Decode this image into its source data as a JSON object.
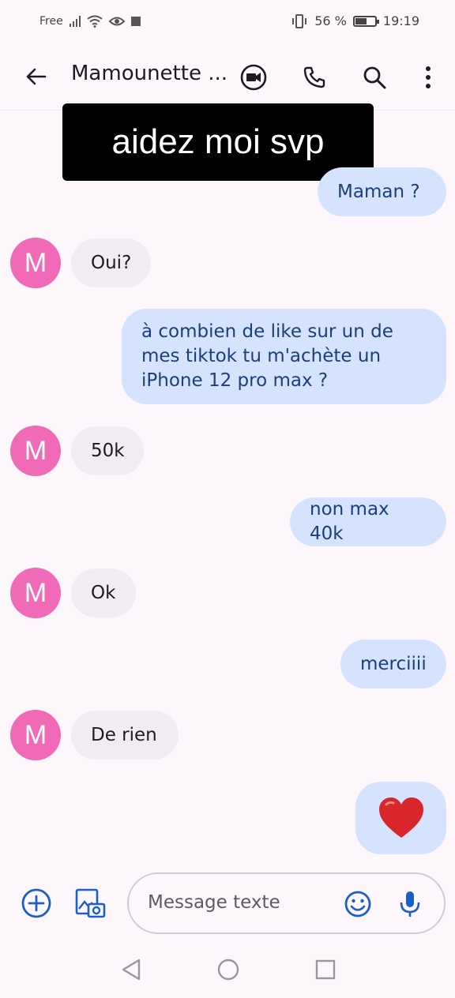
{
  "status_bar": {
    "carrier": "Free",
    "battery_percent": "56 %",
    "battery_level": 0.56,
    "time": "19:19"
  },
  "header": {
    "contact_name": "Mamounette ...",
    "icons": [
      "back-arrow-icon",
      "video-call-icon",
      "phone-icon",
      "search-icon",
      "more-vert-icon"
    ]
  },
  "overlay_caption": "aidez moi svp",
  "messages": [
    {
      "direction": "out",
      "text": "Maman ?"
    },
    {
      "direction": "in",
      "avatar": "M",
      "text": "Oui?"
    },
    {
      "direction": "out",
      "text": "à combien de like sur un de mes tiktok tu m'achète un iPhone 12 pro max ?"
    },
    {
      "direction": "in",
      "avatar": "M",
      "text": "50k"
    },
    {
      "direction": "out",
      "text": "non max 40k"
    },
    {
      "direction": "in",
      "avatar": "M",
      "text": "Ok"
    },
    {
      "direction": "out",
      "text": "merciiii"
    },
    {
      "direction": "in",
      "avatar": "M",
      "text": "De rien"
    },
    {
      "direction": "out",
      "text": "❤️"
    }
  ],
  "composer": {
    "placeholder": "Message texte",
    "icons": [
      "add-icon",
      "gallery-icon",
      "emoji-icon",
      "mic-icon"
    ]
  },
  "colors": {
    "outgoing_bubble": "#d6e3ff",
    "incoming_bubble": "#f1ecf4",
    "avatar": "#f06ab8",
    "accent_blue": "#1a5fc7"
  }
}
